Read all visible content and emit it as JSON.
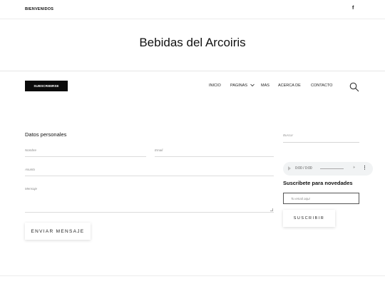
{
  "topbar": {
    "welcome": "BIENVENIDOS",
    "facebook": "f"
  },
  "site": {
    "title": "Bebidas del Arcoiris"
  },
  "nav": {
    "subscribe_label": "SUBSCRIBIRSE",
    "items": [
      {
        "label": "INICIO"
      },
      {
        "label": "PAGINAS"
      },
      {
        "label": "MAS"
      },
      {
        "label": "ACERCA DE"
      },
      {
        "label": "CONTACTO"
      }
    ],
    "search_icon": "search-icon"
  },
  "contact_form": {
    "title": "Datos personales",
    "name_placeholder": "Nombre",
    "email_placeholder": "Email",
    "subject_placeholder": "Asunto",
    "message_placeholder": "Mensaje",
    "send_label": "ENVIAR MENSAJE"
  },
  "sidebar": {
    "search_placeholder": "Buscar",
    "audio": {
      "time": "0:00 / 0:00"
    },
    "newsletter_title": "Suscribete para novedades",
    "email_placeholder": "Tu email aqui",
    "subscribe_label": "SUSCRIBIR"
  }
}
